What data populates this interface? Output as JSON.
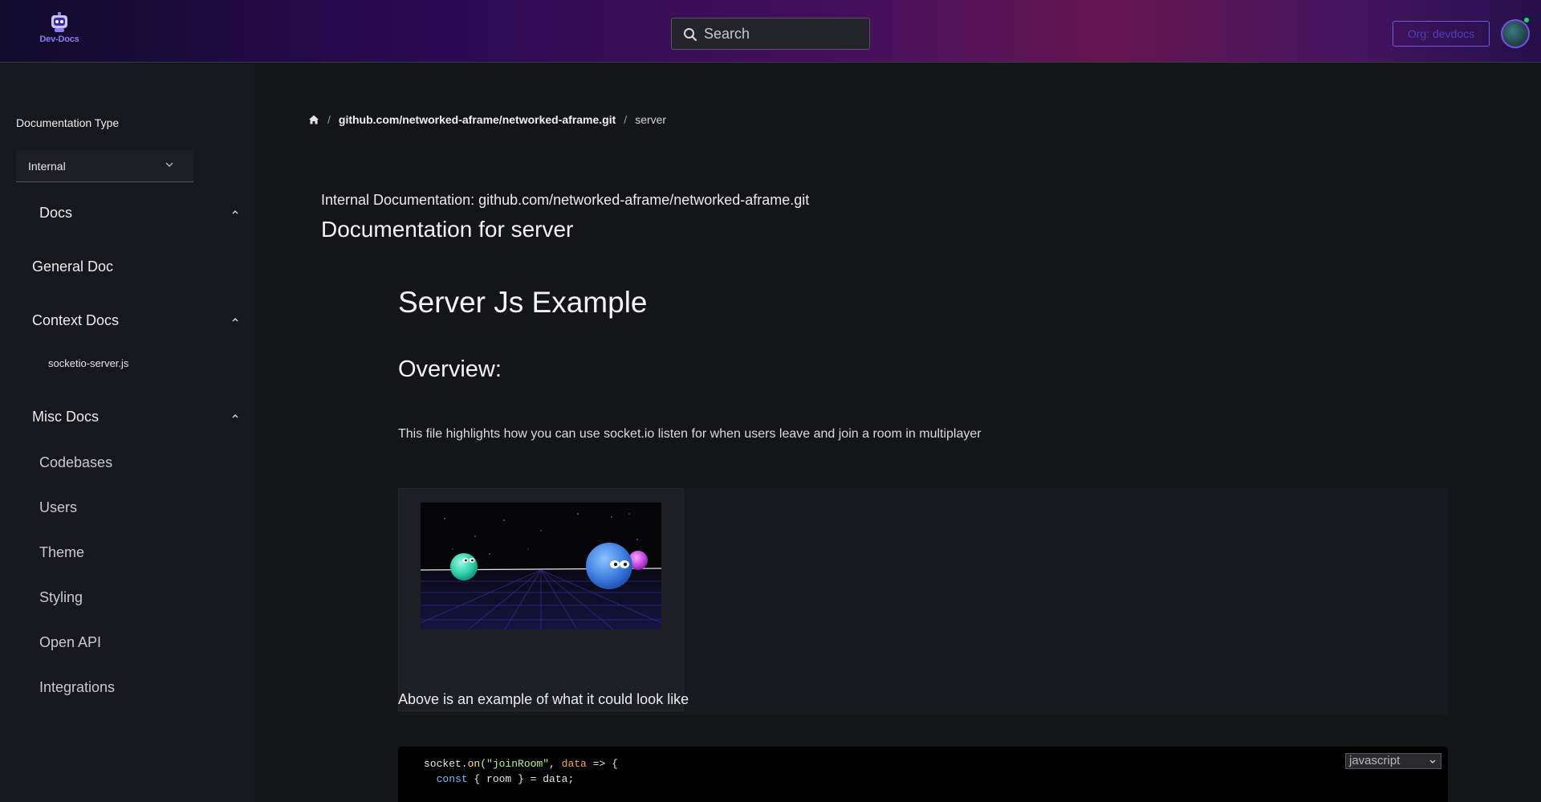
{
  "header": {
    "logo_text": "Dev-Docs",
    "search_placeholder": "Search",
    "org_button": "Org: devdocs"
  },
  "sidebar": {
    "doc_type_label": "Documentation Type",
    "doc_type_value": "Internal",
    "sections": {
      "docs": "Docs",
      "general_doc": "General Doc",
      "context_docs": "Context Docs",
      "context_items": [
        "socketio-server.js"
      ],
      "misc_docs": "Misc Docs",
      "misc_items": [
        "Codebases",
        "Users",
        "Theme",
        "Styling",
        "Open API",
        "Integrations"
      ]
    }
  },
  "breadcrumb": {
    "repo": "github.com/networked-aframe/networked-aframe.git",
    "current": "server",
    "separator": "/"
  },
  "content": {
    "subtitle": "Internal Documentation: github.com/networked-aframe/networked-aframe.git",
    "title": "Documentation for server",
    "h1": "Server Js Example",
    "h2": "Overview:",
    "paragraph": "This file highlights how you can use socket.io listen for when users leave and join a room in multiplayer",
    "after_image": "Above is an example of what it could look like",
    "code_language": "javascript",
    "code": {
      "l1_obj": "socket.",
      "l1_fn": "on",
      "l1_open": "(",
      "l1_str": "\"joinRoom\"",
      "l1_comma": ", ",
      "l1_param": "data",
      "l1_rest": " => {",
      "l2_indent": "  ",
      "l2_kw": "const",
      "l2_rest": " { room } = data;"
    }
  },
  "colors": {
    "accent": "#6e5ce8",
    "background": "#141519",
    "sidebar": "#17181d"
  }
}
